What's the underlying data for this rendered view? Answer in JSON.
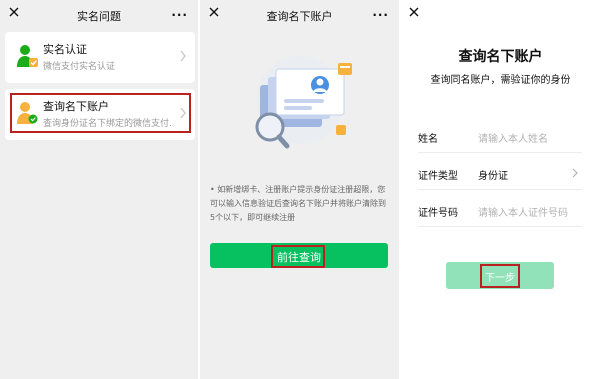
{
  "panel1": {
    "nav_title": "实名问题",
    "more": "···",
    "items": [
      {
        "title": "实名认证",
        "subtitle": "微信支付实名认证"
      },
      {
        "title": "查询名下账户",
        "subtitle": "查询身份证名下绑定的微信支付..."
      }
    ]
  },
  "panel2": {
    "nav_title": "查询名下账户",
    "more": "···",
    "notice": "• 如新增绑卡、注册账户提示身份证注册超限，您可以输入信息验证后查询名下账户并将账户清除到5个以下，即可继续注册",
    "button": "前往查询"
  },
  "panel3": {
    "title": "查询名下账户",
    "subtitle": "查询同名账户，需验证你的身份",
    "fields": [
      {
        "label": "姓名",
        "placeholder": "请输入本人姓名"
      },
      {
        "label": "证件类型",
        "value": "身份证"
      },
      {
        "label": "证件号码",
        "placeholder": "请输入本人证件号码"
      }
    ],
    "button": "下一步"
  },
  "colors": {
    "primary_green": "#07c160",
    "disabled_green": "#91e2b8",
    "highlight_red": "#b8231f",
    "page_bg": "#efefef"
  },
  "icons": [
    "close-icon",
    "more-icon",
    "verified-user-icon",
    "user-search-icon",
    "chevron-right-icon",
    "id-card-search-illustration"
  ]
}
